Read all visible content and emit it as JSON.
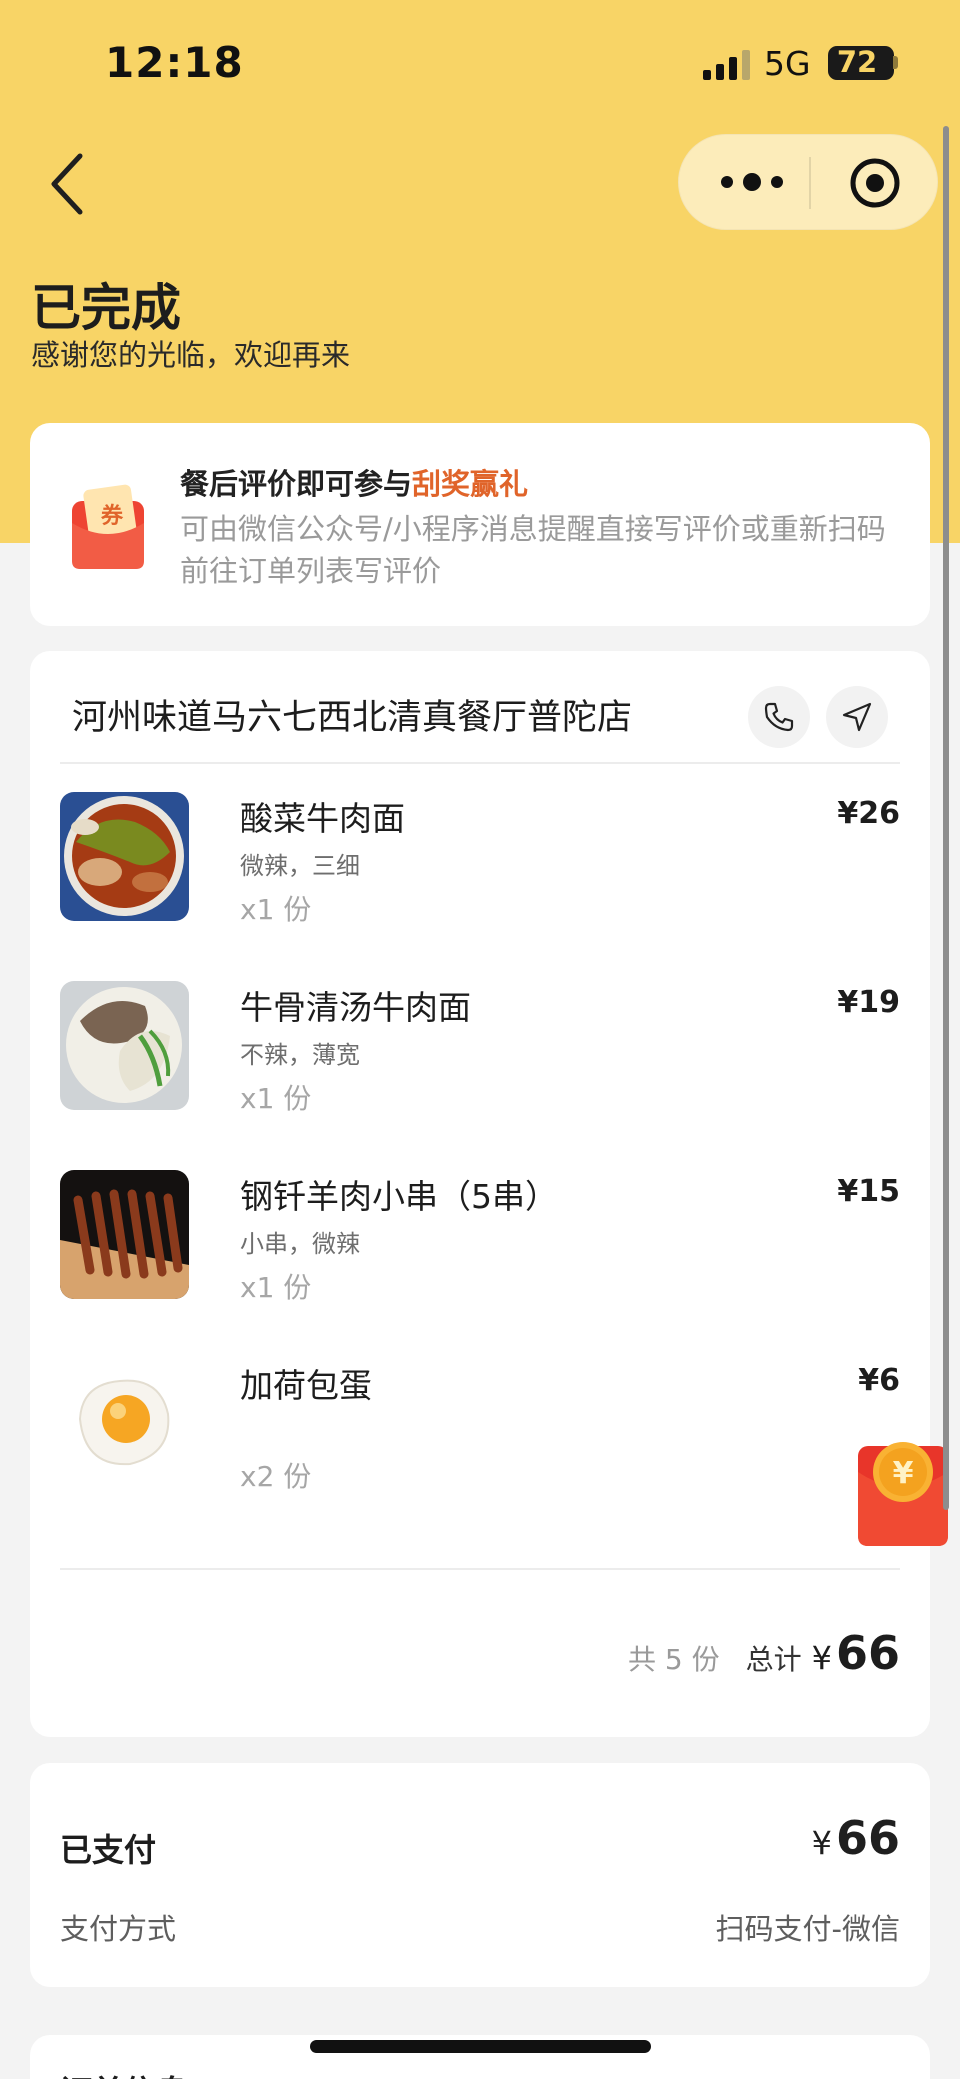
{
  "status_bar": {
    "time": "12:18",
    "network": "5G",
    "battery": "72"
  },
  "header": {
    "title": "已完成",
    "subtitle": "感谢您的光临，欢迎再来"
  },
  "promo": {
    "text_prefix": "餐后评价即可参与",
    "text_highlight": "刮奖赢礼",
    "description": "可由微信公众号/小程序消息提醒直接写评价或重新扫码前往订单列表写评价",
    "envelope_text": "券",
    "highlight_color": "#e0642a"
  },
  "order": {
    "shop_name": "河州味道马六七西北清真餐厅普陀店",
    "items": [
      {
        "name": "酸菜牛肉面",
        "spec": "微辣，三细",
        "qty": "x1 份",
        "price": "¥26"
      },
      {
        "name": "牛骨清汤牛肉面",
        "spec": "不辣，薄宽",
        "qty": "x1 份",
        "price": "¥19"
      },
      {
        "name": "钢钎羊肉小串（5串）",
        "spec": "小串，微辣",
        "qty": "x1 份",
        "price": "¥15"
      },
      {
        "name": "加荷包蛋",
        "spec": "",
        "qty": "x2 份",
        "price": "¥6"
      }
    ],
    "summary": {
      "count": "共 5 份",
      "total_label": "总计",
      "currency": "¥",
      "total": "66"
    }
  },
  "payment": {
    "status_label": "已支付",
    "currency": "¥",
    "amount": "66",
    "method_label": "支付方式",
    "method_value": "扫码支付-微信"
  },
  "order_info": {
    "title": "订单信息"
  },
  "icons": {
    "back": "chevron-left-icon",
    "more": "more-dots-icon",
    "close_target": "target-icon",
    "phone": "phone-icon",
    "navigate": "navigation-icon",
    "red_packet": "red-packet-icon"
  },
  "colors": {
    "header_bg": "#f8d466",
    "accent": "#e0642a",
    "red_packet": "#e8352a"
  }
}
